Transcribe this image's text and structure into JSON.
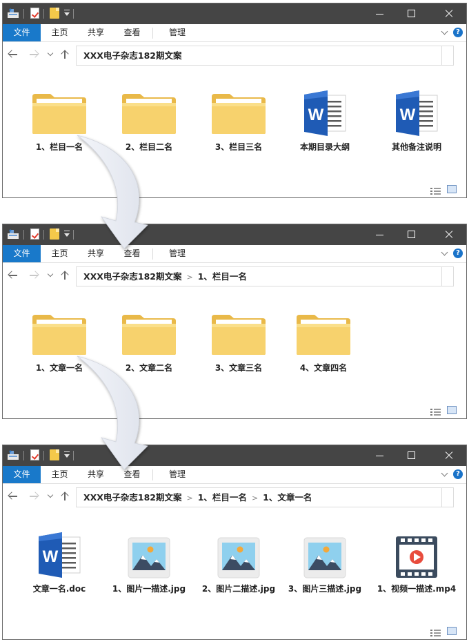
{
  "ribbon": {
    "file": "文件",
    "home": "主页",
    "share": "共享",
    "view": "查看",
    "manage": "管理",
    "help": "?"
  },
  "windows": [
    {
      "breadcrumbs": [
        "XXX电子杂志182期文案"
      ],
      "items": [
        {
          "type": "folder",
          "label": "1、栏目一名"
        },
        {
          "type": "folder",
          "label": "2、栏目二名"
        },
        {
          "type": "folder",
          "label": "3、栏目三名"
        },
        {
          "type": "word",
          "label": "本期目录大纲"
        },
        {
          "type": "word",
          "label": "其他备注说明"
        }
      ]
    },
    {
      "breadcrumbs": [
        "XXX电子杂志182期文案",
        "1、栏目一名"
      ],
      "items": [
        {
          "type": "folder",
          "label": "1、文章一名"
        },
        {
          "type": "folder",
          "label": "2、文章二名"
        },
        {
          "type": "folder",
          "label": "3、文章三名"
        },
        {
          "type": "folder",
          "label": "4、文章四名"
        }
      ]
    },
    {
      "breadcrumbs": [
        "XXX电子杂志182期文案",
        "1、栏目一名",
        "1、文章一名"
      ],
      "items": [
        {
          "type": "word",
          "label": "文章一名.doc"
        },
        {
          "type": "image",
          "label": "1、图片一描述.jpg"
        },
        {
          "type": "image",
          "label": "2、图片二描述.jpg"
        },
        {
          "type": "image",
          "label": "3、图片三描述.jpg"
        },
        {
          "type": "video",
          "label": "1、视频一描述.mp4"
        }
      ]
    }
  ],
  "colors": {
    "titlebar": "#454545",
    "file_tab": "#1979ca",
    "folder": "#f4c94a",
    "word": "#1f5bb5"
  }
}
